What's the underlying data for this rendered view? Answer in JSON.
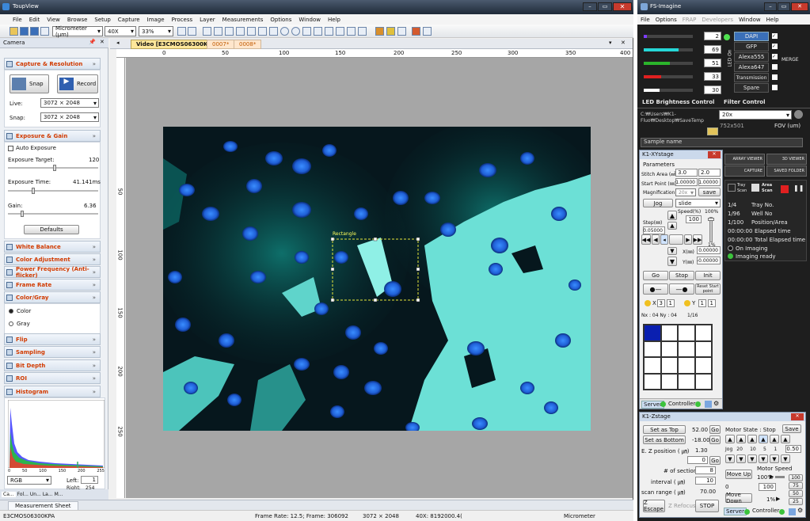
{
  "toupview": {
    "title": "ToupView",
    "menu": [
      "File",
      "Edit",
      "View",
      "Browse",
      "Setup",
      "Capture",
      "Image",
      "Process",
      "Layer",
      "Measurements",
      "Options",
      "Window",
      "Help"
    ],
    "toolbar": {
      "unit": "Micrometer (µm)",
      "magnification": "40X",
      "zoom": "33%"
    },
    "camera_panel": {
      "title": "Camera",
      "capture_section": "Capture & Resolution",
      "snap_label": "Snap",
      "record_label": "Record",
      "live_label": "Live:",
      "live_value": "3072 × 2048",
      "snap_res_label": "Snap:",
      "snap_res_value": "3072 × 2048",
      "exposure_section": "Exposure & Gain",
      "auto_exposure": "Auto Exposure",
      "target_label": "Exposure Target:",
      "target_value": "120",
      "time_label": "Exposure Time:",
      "time_value": "41.141ms",
      "gain_label": "Gain:",
      "gain_value": "6.36",
      "defaults": "Defaults",
      "white_balance": "White Balance",
      "color_adjustment": "Color Adjustment",
      "power_frequency": "Power Frequency (Anti-flicker)",
      "frame_rate": "Frame Rate",
      "color_gray": "Color/Gray",
      "color": "Color",
      "gray": "Gray",
      "flip": "Flip",
      "sampling": "Sampling",
      "bit_depth": "Bit Depth",
      "roi": "ROI",
      "histogram": "Histogram",
      "hist_ticks": [
        "0",
        "50",
        "100",
        "150",
        "200",
        "255"
      ],
      "channel": "RGB",
      "left_label": "Left:",
      "left_value": "1",
      "right_label": "Right:",
      "right_value": "254",
      "bottom_tabs": [
        "Ca...",
        "Fol...",
        "Un...",
        "La...",
        "M..."
      ]
    },
    "tabs": [
      "Video [E3CMOS06300KPA]",
      "0007*",
      "0008*"
    ],
    "ruler_h": [
      "0",
      "50",
      "100",
      "150",
      "200",
      "250",
      "300",
      "350",
      "400"
    ],
    "ruler_v": [
      "50",
      "100",
      "150",
      "200",
      "250"
    ],
    "image_label": "Rectangle",
    "measurement_sheet": "Measurement Sheet",
    "status": {
      "camera": "E3CMOS06300KPA",
      "frame": "Frame Rate: 12.5; Frame: 306092",
      "resolution": "3072 × 2048",
      "mag": "40X: 8192000.4(",
      "unit": "Micrometer"
    }
  },
  "imagine": {
    "title": "FS-Imagine",
    "menu": [
      "File",
      "Options",
      "FRAP",
      "Developers",
      "Window",
      "Help"
    ],
    "led_values": [
      "2",
      "69",
      "51",
      "33",
      "30"
    ],
    "led_colors": [
      "#7d3cff",
      "#26d7d7",
      "#2bb52b",
      "#e02020",
      "#ffffff"
    ],
    "led_on": "LED On",
    "filters": [
      "DAPI",
      "GFP",
      "Alexa555",
      "Alexa647",
      "Transmission",
      "Spare"
    ],
    "merge": "MERGE",
    "led_brightness": "LED Brightness Control",
    "filter_control": "Filter Control",
    "path": "C:₩Users₩K1-Fluo₩Desktop₩SaveTemp",
    "objective": "20x",
    "fov_value": "752x501",
    "fov_label": "FOV (um)",
    "sample_name": "Sample name",
    "xy": {
      "title": "K1-XYstage",
      "parameters": "Parameters",
      "stitch_label": "Stitch Area (㎟)",
      "stitch_x": "3.0",
      "stitch_y": "2.0",
      "start_label": "Start Point (㎜)",
      "start_x": "1.00000",
      "start_y": "1.00000",
      "mag_label": "Magnification",
      "mag_value": "20x",
      "save": "save",
      "jog": "Jog",
      "slide": "slide",
      "speed_label": "Speed(%)",
      "speed_pct": "100%",
      "speed_value": "100",
      "step_label": "Step(㎜)",
      "step_value": "0.05000",
      "one_pct": "1%",
      "x_label": "X(㎜)",
      "x_value": "0.00000",
      "y_label": "Y(㎜)",
      "y_value": "-0.00000",
      "go": "Go",
      "stop": "Stop",
      "init": "Init",
      "reset": "Reset Start point",
      "x_lbl": "X",
      "x_a": "3",
      "x_b": "1",
      "y_lbl": "Y",
      "y_a": "1",
      "y_b": "1",
      "nx_ny": "Nx : 04  Ny : 04",
      "tile_count": "1/16",
      "server": "Server",
      "controller": "Controller"
    },
    "array_viewer": "ARRAY VIEWER",
    "viewer_3d": "3D VIEWER",
    "capture": "CAPTURE",
    "saved_folder": "SAVED FOLDER",
    "tray_scan": "Tray Scan",
    "area_scan": "Area Scan",
    "status_lines": [
      [
        "1/4",
        "Tray No."
      ],
      [
        "1/96",
        "Well No"
      ],
      [
        "1/100",
        "Position/Area"
      ],
      [
        "00:00:00",
        "Elapsed time"
      ],
      [
        "00:00:00",
        "Total Elapsed time"
      ]
    ],
    "on_imaging": "On Imaging",
    "imaging_ready": "Imaging ready",
    "z": {
      "title": "K1-Zstage",
      "set_top": "Set as Top",
      "top_value": "52.00",
      "set_bottom": "Set as Bottom",
      "bottom_value": "-18.00",
      "go": "Go",
      "motor_state": "Motor State :  Stop",
      "save": "Save",
      "ezpos_label": "E. Z position  ( ㎛)",
      "ezpos_value": "1.30",
      "jog_labels": [
        "Jog",
        "20㎛",
        "10㎛",
        "5㎛",
        "1㎛"
      ],
      "jog_value": "0.50",
      "zero_value": "0",
      "sections_label": "# of section",
      "sections_value": "8",
      "interval_label": "interval  ( ㎛)",
      "interval_value": "10",
      "range_label": "scan range  ( ㎛)",
      "range_value": "70.00",
      "move_up": "Move Up",
      "move_down": "Move Down",
      "motor_speed": "Motor Speed",
      "speed_pct": "100%",
      "speed_value": "100",
      "zero": "0",
      "one_pct": "1%",
      "quick": [
        "100",
        "75",
        "50",
        "25"
      ],
      "z_escape": "Z Escape",
      "z_refocus": "Z Refocus",
      "stop": "STOP",
      "server": "Server",
      "controller": "Controller"
    }
  }
}
